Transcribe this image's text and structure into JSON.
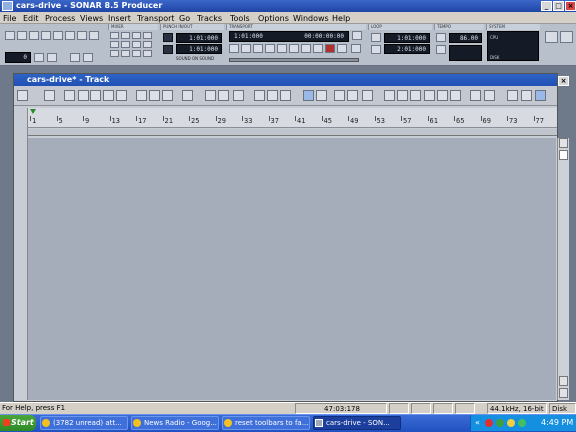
{
  "window": {
    "title": "cars-drive - SONAR 8.5 Producer"
  },
  "menu": [
    "File",
    "Edit",
    "Process",
    "Views",
    "Insert",
    "Transport",
    "Go",
    "Tracks",
    "Tools",
    "Options",
    "Windows",
    "Help"
  ],
  "modules": {
    "mixer_label": "MIXER",
    "punch_label": "PUNCH IN/OUT",
    "punch_in": "1:01:000",
    "punch_out": "1:01:000",
    "sound_label": "SOUND ON SOUND",
    "transport_label": "TRANSPORT",
    "transport_now": "1:01:000",
    "transport_time": "00:00:00:00",
    "loop_label": "LOOP",
    "loop_start": "1:01:000",
    "loop_end": "2:01:000",
    "tempo_label": "TEMPO",
    "tempo": "86.00",
    "system_label": "SYSTEM",
    "cpu": "CPU",
    "disk": "DISK",
    "left_value": "0"
  },
  "track": {
    "title": "cars-drive* - Track",
    "ruler": [
      "1",
      "5",
      "9",
      "13",
      "17",
      "21",
      "25",
      "29",
      "33",
      "37",
      "41",
      "45",
      "49",
      "53",
      "57",
      "61",
      "65",
      "69",
      "73",
      "77"
    ]
  },
  "status": {
    "help": "For Help, press F1",
    "time": "47:03:178",
    "format": "44.1kHz, 16-bit",
    "disk": "Disk sp"
  },
  "taskbar": {
    "start": "Start",
    "tasks": [
      "(3782 unread) att...",
      "News Radio - Goog...",
      "reset toolbars to fa...",
      "cars-drive - SON..."
    ],
    "clock": "4:49 PM"
  },
  "colors": {
    "title_bar": "#2050b4",
    "clip_area": "#a4adb9",
    "taskbar": "#2151c0"
  }
}
